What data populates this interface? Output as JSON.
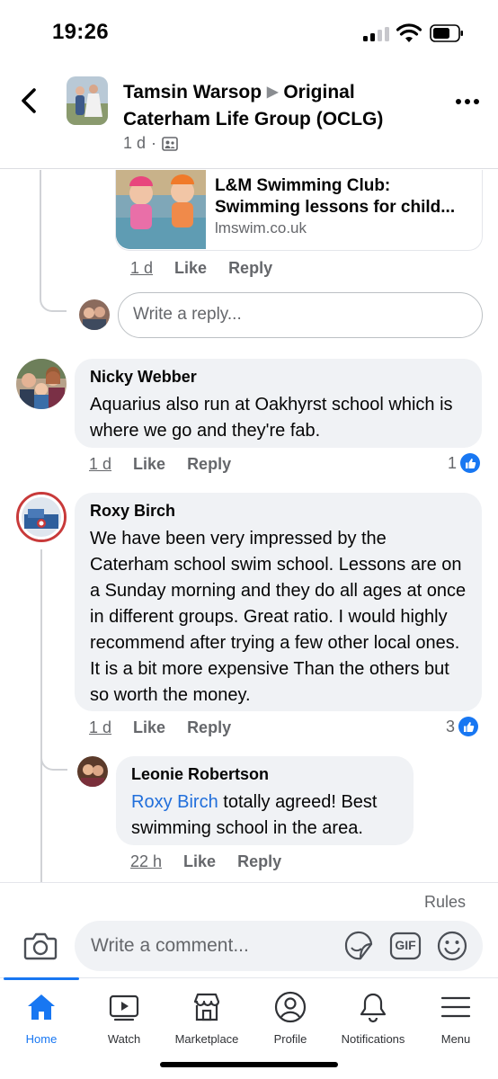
{
  "status_bar": {
    "time": "19:26"
  },
  "header": {
    "author": "Tamsin Warsop",
    "group": "Original Caterham Life Group (OCLG)",
    "time": "1 d",
    "dot": "·"
  },
  "link_preview": {
    "title_line1": "L&M Swimming Club:",
    "title_line2": "Swimming lessons for child...",
    "domain": "lmswim.co.uk",
    "time": "1 d",
    "like": "Like",
    "reply": "Reply"
  },
  "reply_box": {
    "placeholder": "Write a reply..."
  },
  "comments": [
    {
      "name": "Nicky Webber",
      "text": "Aquarius also run at Oakhyrst school which is where we go and they're fab.",
      "time": "1 d",
      "like": "Like",
      "reply": "Reply",
      "reactions": "1"
    },
    {
      "name": "Roxy Birch",
      "text": "We have been very impressed by the Caterham school swim school. Lessons are on a Sunday morning and they do all ages at once in different groups. Great ratio. I would highly recommend after trying a few other local ones. It is a bit more expensive Than the others but so worth the money.",
      "time": "1 d",
      "like": "Like",
      "reply": "Reply",
      "reactions": "3"
    }
  ],
  "nested_reply": {
    "name": "Leonie Robertson",
    "mention": "Roxy Birch",
    "text": " totally agreed! Best swimming school in the area.",
    "time": "22 h",
    "like": "Like",
    "reply": "Reply"
  },
  "composer": {
    "rules": "Rules",
    "placeholder": "Write a comment...",
    "gif": "GIF"
  },
  "tabs": [
    {
      "label": "Home",
      "icon": "home-icon",
      "active": true
    },
    {
      "label": "Watch",
      "icon": "watch-icon"
    },
    {
      "label": "Marketplace",
      "icon": "marketplace-icon"
    },
    {
      "label": "Profile",
      "icon": "profile-icon"
    },
    {
      "label": "Notifications",
      "icon": "bell-icon"
    },
    {
      "label": "Menu",
      "icon": "menu-icon"
    }
  ],
  "colors": {
    "accent": "#1877f2",
    "mention": "#216fdb",
    "bubble": "#f0f2f5",
    "muted": "#65676b"
  }
}
